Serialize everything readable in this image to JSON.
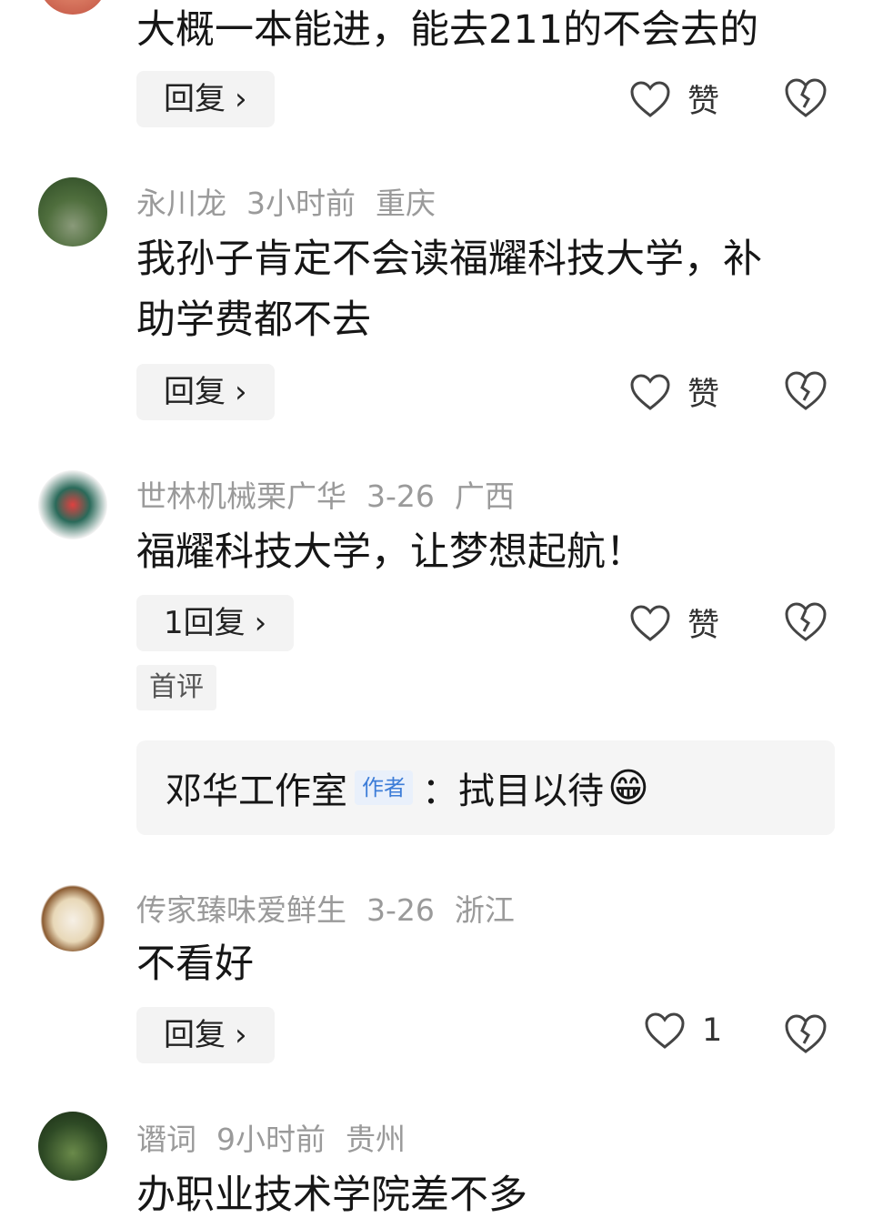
{
  "comments": [
    {
      "author": "",
      "time": "",
      "region": "",
      "text": "大概一本能进，能去211的不会去的",
      "reply_label": "回复",
      "like_label": "赞"
    },
    {
      "author": "永川龙",
      "time": "3小时前",
      "region": "重庆",
      "text": "我孙子肯定不会读福耀科技大学，补\n助学费都不去",
      "reply_label": "回复",
      "like_label": "赞"
    },
    {
      "author": "世林机械栗广华",
      "time": "3-26",
      "region": "广西",
      "text": "福耀科技大学，让梦想起航！",
      "reply_label": "1回复",
      "like_label": "赞",
      "tag": "首评",
      "sub_reply": {
        "author": "邓华工作室",
        "badge": "作者",
        "text": "：拭目以待",
        "emoji": "😁"
      }
    },
    {
      "author": "传家臻味爱鲜生",
      "time": "3-26",
      "region": "浙江",
      "text": "不看好",
      "reply_label": "回复",
      "like_label": "1"
    },
    {
      "author": "谮词",
      "time": "9小时前",
      "region": "贵州",
      "text": "办职业技术学院差不多"
    }
  ],
  "icons": {
    "like": "heart-outline-icon",
    "dislike": "broken-heart-icon",
    "chevron": "chevron-right-icon"
  },
  "colors": {
    "meta": "#9a9a9a",
    "button_bg": "#f3f3f3",
    "author_badge": "#3d7dd8"
  }
}
